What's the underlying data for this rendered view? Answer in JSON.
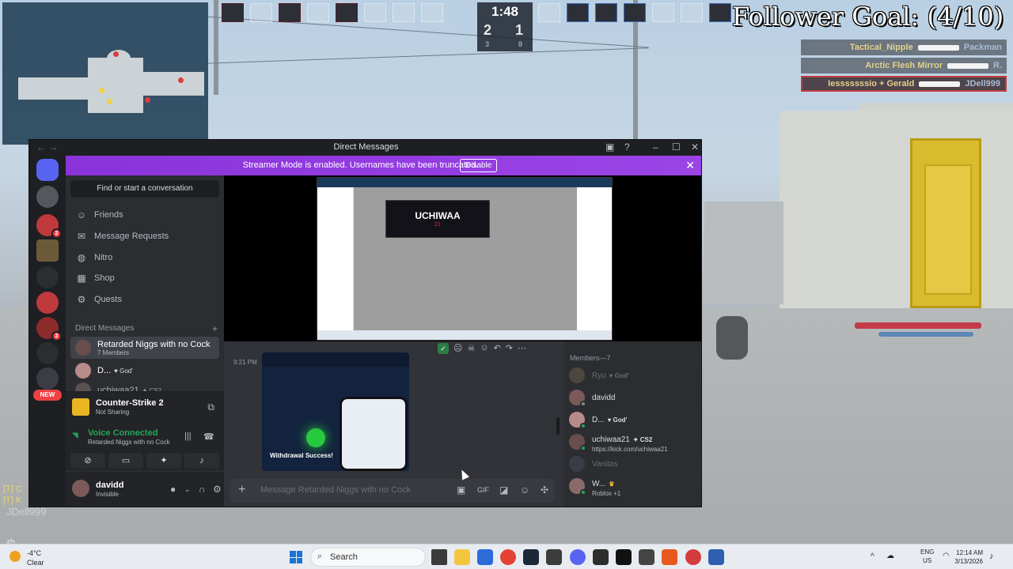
{
  "hud": {
    "timer": "1:48",
    "score_t": "2",
    "score_ct": "1",
    "alive_t": "3",
    "alive_ct": "8",
    "follower_goal": "Follower Goal: (4/10)",
    "killfeed": [
      {
        "killer": "Tactical_Nipple",
        "victim": "Packman"
      },
      {
        "killer": "Arctic Flesh Mirror",
        "victim": "R."
      },
      {
        "killer": "Iesssssssio + Gerald",
        "victim": "JDell999"
      }
    ],
    "player_name": "JDell999",
    "chat_prefix_1": "[T] C",
    "chat_prefix_2": "[T] K"
  },
  "discord": {
    "window_title": "Direct Messages",
    "streamer_banner": "Streamer Mode is enabled. Usernames have been truncated.",
    "disable_label": "Disable",
    "find_placeholder": "Find or start a conversation",
    "nav": [
      "Friends",
      "Message Requests",
      "Nitro",
      "Shop",
      "Quests"
    ],
    "dm_header": "Direct Messages",
    "dms": [
      {
        "name": "Retarded Niggs with no Cock",
        "sub": "7 Members"
      },
      {
        "name": "D...",
        "tag": "God'"
      },
      {
        "name": "uchiwaa21",
        "tag": "CS2"
      }
    ],
    "guild_new_label": "NEW",
    "guild_badges": [
      "2",
      "2"
    ],
    "game": {
      "title": "Counter-Strike 2",
      "sub": "Not Sharing"
    },
    "voice": {
      "title": "Voice Connected",
      "channel": "Retarded Niggs with no Cock"
    },
    "user": {
      "name": "davidd",
      "status": "Invisible"
    },
    "stream_banner_title": "UCHIWAA",
    "stream_banner_sub": "21",
    "message_time": "9:21 PM",
    "image_caption": "Withdrawal Success!",
    "composer_placeholder": "Message Retarded Niggs with no Cock",
    "members_header": "Members—7",
    "members": [
      {
        "name": "Ryu",
        "tag": "God'",
        "dim": true
      },
      {
        "name": "davidd",
        "status_color": "#80848e"
      },
      {
        "name": "D...",
        "tag": "God'",
        "status_color": "#23a55a"
      },
      {
        "name": "uchiwaa21",
        "tag": "CS2",
        "sub": "https://kick.com/uchiwaa21",
        "status_color": "#23a55a"
      },
      {
        "name": "Vanitas",
        "dim": true
      },
      {
        "name": "W...",
        "sub": "Roblox +1",
        "status_color": "#23a55a"
      }
    ]
  },
  "taskbar": {
    "temp": "-4°C",
    "weather": "Clear",
    "search_label": "Search",
    "lang_1": "ENG",
    "lang_2": "US",
    "time": "12:14 AM",
    "date": "3/13/2026"
  }
}
